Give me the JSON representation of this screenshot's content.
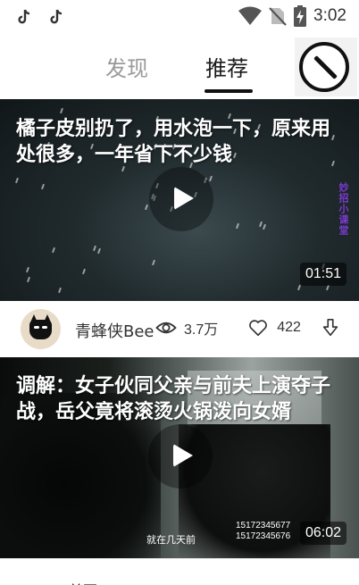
{
  "status_bar": {
    "time": "3:02",
    "icons": [
      "tiktok-icon",
      "tiktok-icon",
      "wifi-icon",
      "no-sim-icon",
      "battery-charging-icon"
    ]
  },
  "top_nav": {
    "tabs": [
      {
        "label": "发现",
        "active": false
      },
      {
        "label": "推荐",
        "active": true
      }
    ],
    "action_icon": "no-entry-circle-icon"
  },
  "videos": [
    {
      "title": "橘子皮别扔了，用水泡一下，原来用处很多，一年省下不少钱",
      "duration": "01:51",
      "side_watermark": "妙招小课堂"
    },
    {
      "title": "调解：女子伙同父亲与前夫上演夺子战，岳父竟将滚烫火锅泼向女婿",
      "duration": "06:02",
      "subtitle": "就在几天前",
      "phone_lines": [
        "15172345677",
        "15172345676"
      ]
    }
  ],
  "author": {
    "name": "青蜂侠Bee",
    "views": "3.7万",
    "likes": "422"
  },
  "bottom_nav": {
    "home_label": "首页"
  },
  "colors": {
    "active_tab": "#1a1a1a",
    "inactive_tab": "#9a9a9a",
    "watermark": "#7c3ad0"
  }
}
